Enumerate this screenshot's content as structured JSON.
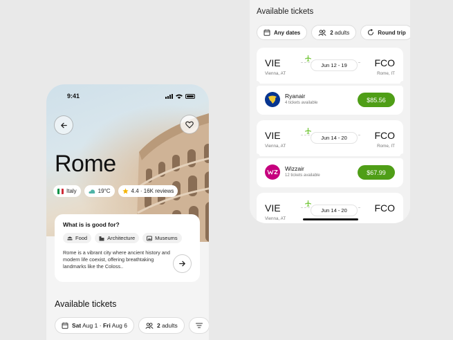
{
  "left_screen": {
    "status_time": "9:41",
    "city": "Rome",
    "chips": [
      {
        "icon": "italy-flag-icon",
        "label": "Italy"
      },
      {
        "icon": "weather-icon",
        "label": "19°C"
      },
      {
        "icon": "star-icon",
        "label": "4.4 · 16K reviews"
      }
    ],
    "good_for": {
      "heading": "What is is good for?",
      "tags": [
        {
          "icon": "food-icon",
          "label": "Food"
        },
        {
          "icon": "architecture-icon",
          "label": "Architecture"
        },
        {
          "icon": "museum-icon",
          "label": "Museums"
        }
      ],
      "description": "Rome is a vibrant city where ancient history and modern life coexist, offering breathtaking landmarks like the Coloss.."
    },
    "tickets_title": "Available tickets",
    "filters": {
      "date_from_day": "Sat",
      "date_from": "Aug 1",
      "date_sep": "·",
      "date_to_day": "Fri",
      "date_to": "Aug 6",
      "adults_count": "2",
      "adults_label": "adults"
    }
  },
  "right_screen": {
    "tickets_title": "Available tickets",
    "filters": {
      "dates": "Any dates",
      "adults_count": "2",
      "adults_label": "adults",
      "trip": "Round trip"
    },
    "tickets": [
      {
        "from": "VIE",
        "from_city": "Vienna, AT",
        "to": "FCO",
        "to_city": "Rome, IT",
        "dates": "Jun 12 - 19",
        "airline": "Ryanair",
        "availability": "4 tickets available",
        "price": "$85.56"
      },
      {
        "from": "VIE",
        "from_city": "Vienna, AT",
        "to": "FCO",
        "to_city": "Rome, IT",
        "dates": "Jun 14 - 20",
        "airline": "Wizzair",
        "availability": "12 tickets available",
        "price": "$67.99"
      },
      {
        "from": "VIE",
        "from_city": "Vienna, AT",
        "to": "FCO",
        "to_city": "",
        "dates": "Jun 14 - 20"
      }
    ],
    "colors": {
      "accent": "#4f9e17",
      "plane": "#7ac943",
      "ryanair": "#073590",
      "wizzair": "#c6007e"
    }
  }
}
